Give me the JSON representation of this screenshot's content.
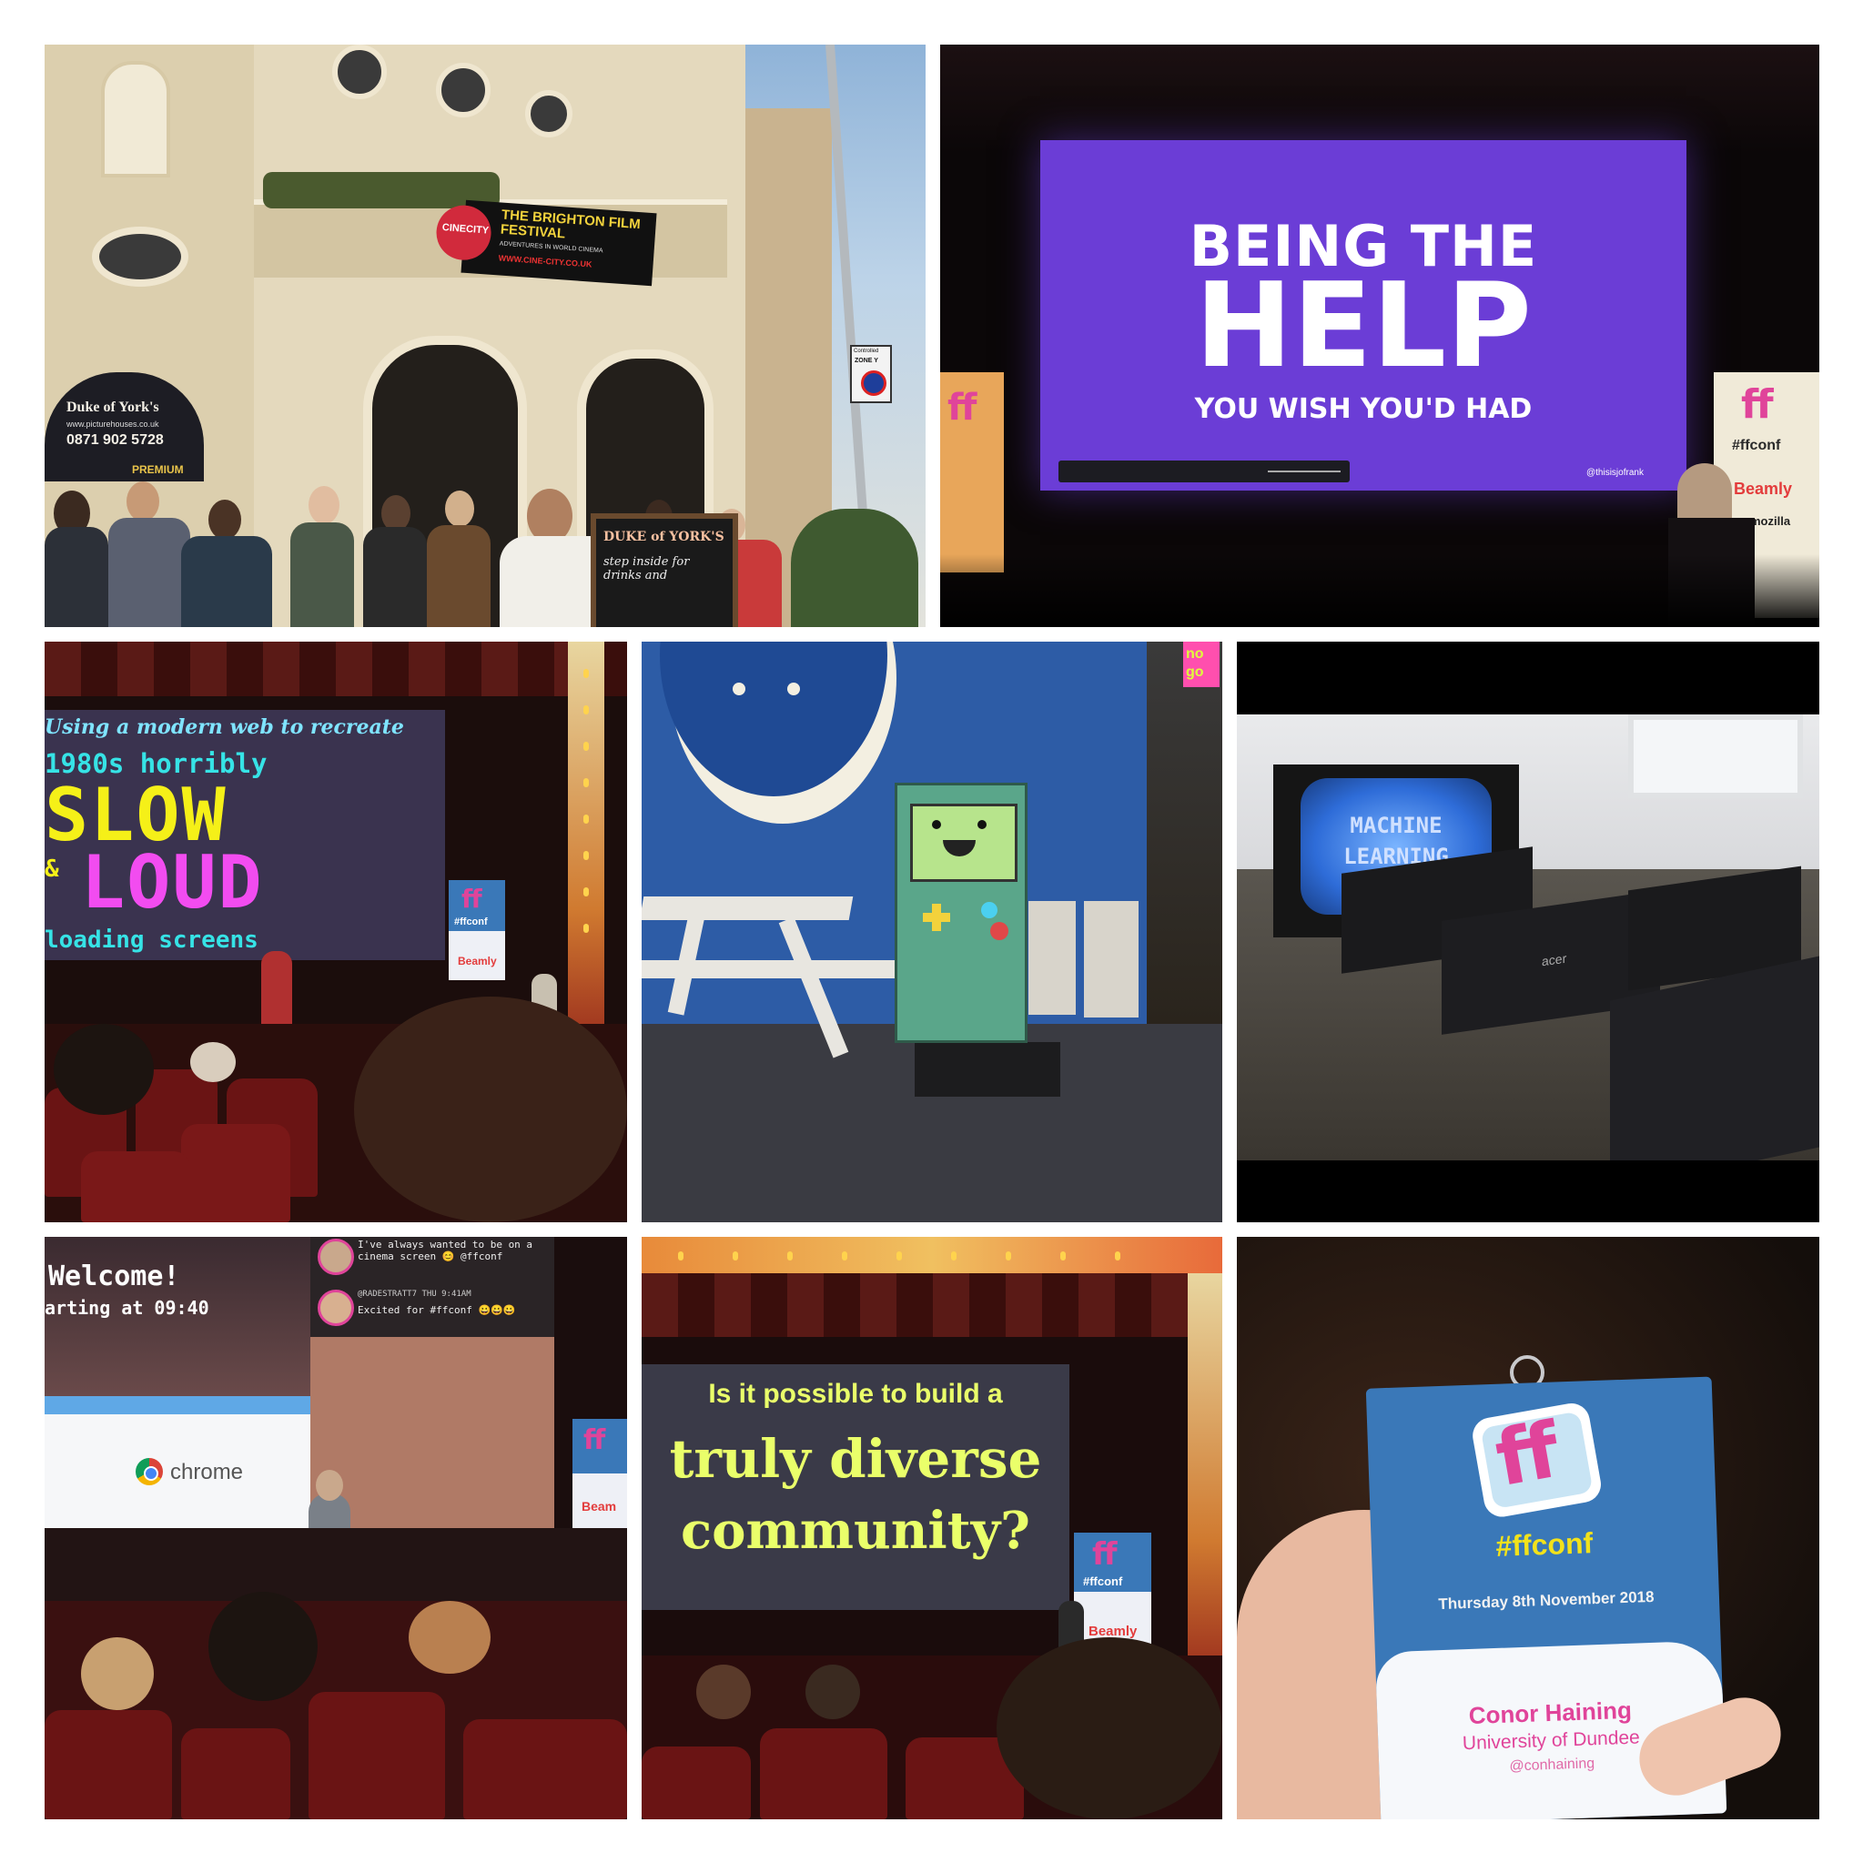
{
  "photo1": {
    "sign_name": "Duke of York's",
    "sign_url": "www.picturehouses.co.uk",
    "sign_phone": "0871 902 5728",
    "premium": "PREMIUM",
    "banner_brand": "CINECITY",
    "banner_title": "THE BRIGHTON FILM FESTIVAL",
    "banner_sub": "ADVENTURES IN WORLD CINEMA",
    "banner_url": "WWW.CINE-CITY.CO.UK",
    "road_sign_top": "Controlled",
    "road_sign_zone": "ZONE Y",
    "chalkboard_title": "DUKE of YORK'S",
    "chalkboard_text": "step inside for drinks and"
  },
  "photo2": {
    "line1": "BEING THE",
    "line2": "HELP",
    "line3": "YOU WISH YOU'D HAD",
    "handle": "@thisisjofrank",
    "banner_tag": "#ffconf",
    "sponsor": "Beamly",
    "sponsor2": "mozilla"
  },
  "photo3": {
    "line1": "Using a modern web to recreate",
    "line2": "1980s horribly",
    "line3": "SLOW",
    "line4": "&",
    "line5": "LOUD",
    "line6": "loading screens",
    "banner_tag": "#ffconf",
    "sponsor": "Beamly"
  },
  "photo4": {
    "neon_sign": "no go"
  },
  "photo5": {
    "screen_line1": "MACHINE",
    "screen_line2": "LEARNING",
    "monitor_brand": "acer"
  },
  "photo6": {
    "welcome": "Welcome!",
    "starting": "arting at 09:40",
    "tweet1": "I've always wanted to be on a cinema screen 😊 @ffconf",
    "tweet2_user": "@RADESTRATT7  THU 9:41AM",
    "tweet2": "Excited for #ffconf 😀😀😀",
    "chrome": "chrome",
    "sponsor": "Beam"
  },
  "photo7": {
    "line1": "Is it possible to build a",
    "line2": "truly diverse",
    "line3": "community?",
    "banner_tag": "#ffconf",
    "sponsor": "Beamly"
  },
  "photo8": {
    "logo": "ff",
    "tag": "#ffconf",
    "date": "Thursday 8th November 2018",
    "name": "Conor Haining",
    "org": "University of Dundee",
    "handle": "@conhaining"
  },
  "colors": {
    "slide_purple": "#6b3dd6",
    "badge_blue": "#3a78b8",
    "ff_pink": "#e0449a",
    "ffconf_yellow": "#f2e21b",
    "retro_yellow": "#f5f018",
    "retro_magenta": "#f24cf0",
    "retro_cyan": "#36e3e6"
  }
}
